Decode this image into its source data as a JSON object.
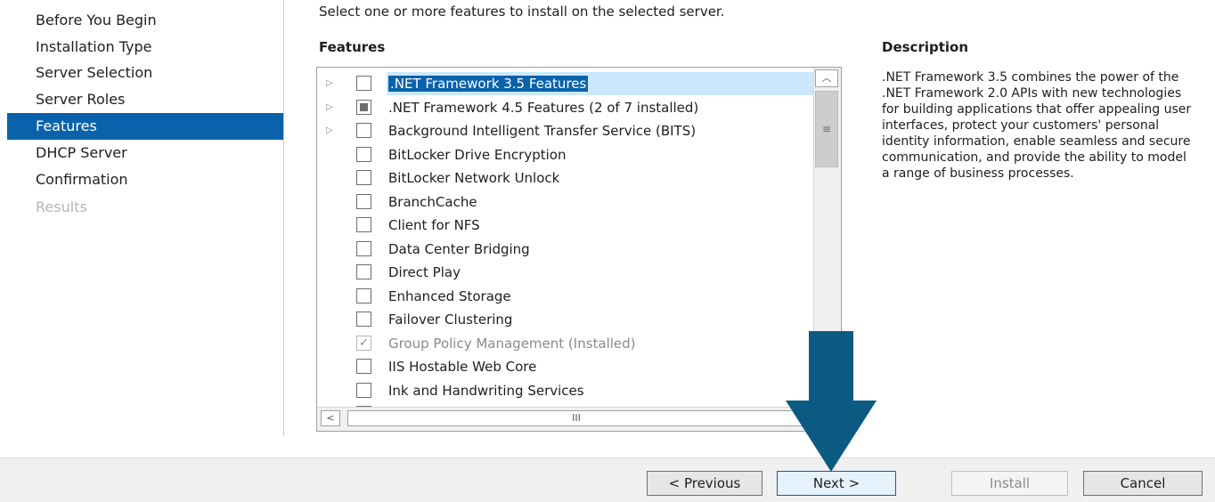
{
  "nav": {
    "items": [
      {
        "label": "Before You Begin",
        "state": "normal"
      },
      {
        "label": "Installation Type",
        "state": "normal"
      },
      {
        "label": "Server Selection",
        "state": "normal"
      },
      {
        "label": "Server Roles",
        "state": "normal"
      },
      {
        "label": "Features",
        "state": "active"
      },
      {
        "label": "DHCP Server",
        "state": "normal"
      },
      {
        "label": "Confirmation",
        "state": "normal"
      },
      {
        "label": "Results",
        "state": "disabled"
      }
    ]
  },
  "main": {
    "instruction": "Select one or more features to install on the selected server.",
    "features_heading": "Features",
    "description_heading": "Description",
    "description_text": ".NET Framework 3.5 combines the power of the .NET Framework 2.0 APIs with new technologies for building applications that offer appealing user interfaces, protect your customers' personal identity information, enable seamless and secure communication, and provide the ability to model a range of business processes.",
    "features": [
      {
        "label": ".NET Framework 3.5 Features",
        "expandable": true,
        "check": "unchecked",
        "selected": true
      },
      {
        "label": ".NET Framework 4.5 Features (2 of 7 installed)",
        "expandable": true,
        "check": "partial"
      },
      {
        "label": "Background Intelligent Transfer Service (BITS)",
        "expandable": true,
        "check": "unchecked"
      },
      {
        "label": "BitLocker Drive Encryption",
        "expandable": false,
        "check": "unchecked"
      },
      {
        "label": "BitLocker Network Unlock",
        "expandable": false,
        "check": "unchecked"
      },
      {
        "label": "BranchCache",
        "expandable": false,
        "check": "unchecked"
      },
      {
        "label": "Client for NFS",
        "expandable": false,
        "check": "unchecked"
      },
      {
        "label": "Data Center Bridging",
        "expandable": false,
        "check": "unchecked"
      },
      {
        "label": "Direct Play",
        "expandable": false,
        "check": "unchecked"
      },
      {
        "label": "Enhanced Storage",
        "expandable": false,
        "check": "unchecked"
      },
      {
        "label": "Failover Clustering",
        "expandable": false,
        "check": "unchecked"
      },
      {
        "label": "Group Policy Management (Installed)",
        "expandable": false,
        "check": "checked-disabled"
      },
      {
        "label": "IIS Hostable Web Core",
        "expandable": false,
        "check": "unchecked"
      },
      {
        "label": "Ink and Handwriting Services",
        "expandable": false,
        "check": "unchecked"
      }
    ],
    "icons": {
      "expander": "expand-triangle-icon",
      "scroll_up": "scroll-up-arrow-icon",
      "scroll_left": "scroll-left-arrow-icon",
      "scroll_right": "scroll-right-arrow-icon"
    }
  },
  "footer": {
    "previous_label": "< Previous",
    "next_label": "Next >",
    "install_label": "Install",
    "cancel_label": "Cancel"
  },
  "colors": {
    "accent": "#0a62aa",
    "arrow": "#0b5a82",
    "selection": "#cce8ff"
  }
}
